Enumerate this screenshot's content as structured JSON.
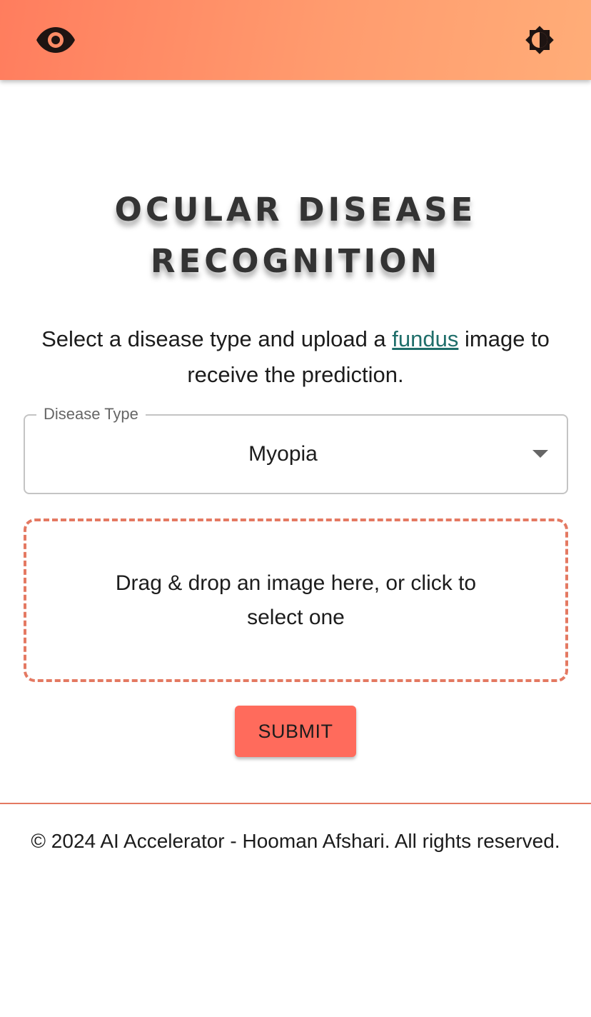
{
  "header": {
    "logo_icon": "eye-icon",
    "theme_toggle_icon": "brightness-icon",
    "colors": {
      "gradient_start": "#ff7d5e",
      "gradient_end": "#ffad78"
    }
  },
  "main": {
    "title_line1": "OCULAR DISEASE",
    "title_line2": "RECOGNITION",
    "description_before": "Select a disease type and upload a",
    "description_link": "fundus",
    "description_after": "image to receive the prediction.",
    "disease_select": {
      "label": "Disease Type",
      "selected": "Myopia"
    },
    "dropzone_text": "Drag & drop an image here, or click to select one",
    "submit_label": "SUBMIT",
    "colors": {
      "accent": "#ff6b5c",
      "dropzone_border": "#e47962",
      "link": "#1f6e6a"
    }
  },
  "footer": {
    "text": "© 2024 AI Accelerator - Hooman Afshari. All rights reserved."
  }
}
